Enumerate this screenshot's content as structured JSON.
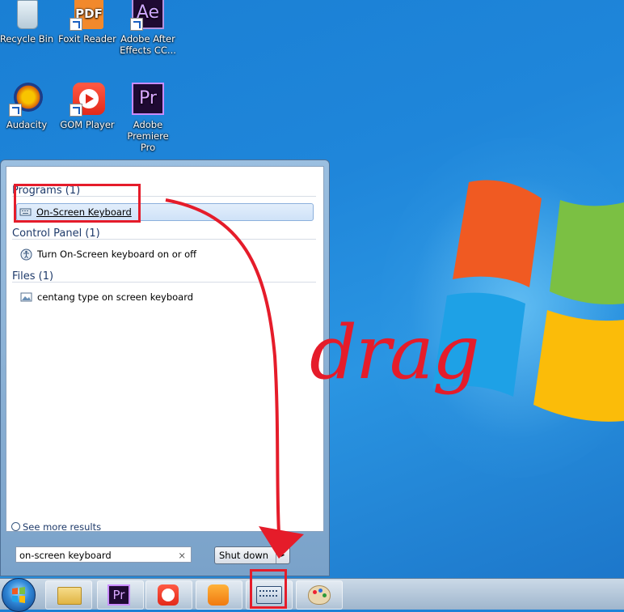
{
  "desktop": {
    "icons": [
      {
        "label": "Recycle Bin",
        "icon": "recycle-bin-icon"
      },
      {
        "label": "Foxit Reader",
        "icon": "foxit-reader-icon",
        "glyph": "PDF"
      },
      {
        "label": "Adobe After Effects CC...",
        "icon": "after-effects-icon",
        "glyph": "Ae"
      },
      {
        "label": "Audacity",
        "icon": "audacity-icon"
      },
      {
        "label": "GOM Player",
        "icon": "gom-player-icon"
      },
      {
        "label": "Adobe Premiere Pro",
        "icon": "premiere-pro-icon",
        "glyph": "Pr"
      }
    ]
  },
  "start_menu": {
    "groups": [
      {
        "title": "Programs (1)",
        "items": [
          {
            "label": "On-Screen Keyboard",
            "icon": "keyboard-icon",
            "selected": true
          }
        ]
      },
      {
        "title": "Control Panel (1)",
        "items": [
          {
            "label": "Turn On-Screen keyboard on or off",
            "icon": "ease-of-access-icon"
          }
        ]
      },
      {
        "title": "Files (1)",
        "items": [
          {
            "label": "centang type on screen keyboard",
            "icon": "image-file-icon"
          }
        ]
      }
    ],
    "see_more": "See more results",
    "search_value": "on-screen keyboard",
    "search_clear": "×",
    "shutdown_label": "Shut down",
    "shutdown_arrow": "▸"
  },
  "taskbar": {
    "items": [
      {
        "name": "windows-explorer",
        "icon": "folder-icon"
      },
      {
        "name": "premiere-pro",
        "icon": "premiere-pro-icon",
        "glyph": "Pr"
      },
      {
        "name": "gom-player",
        "icon": "gom-player-icon"
      },
      {
        "name": "uc-browser",
        "icon": "uc-browser-icon"
      },
      {
        "name": "on-screen-keyboard",
        "icon": "keyboard-icon"
      },
      {
        "name": "paint",
        "icon": "paint-palette-icon"
      }
    ]
  },
  "annotation": {
    "text": "drag",
    "color": "#e51c2a"
  }
}
